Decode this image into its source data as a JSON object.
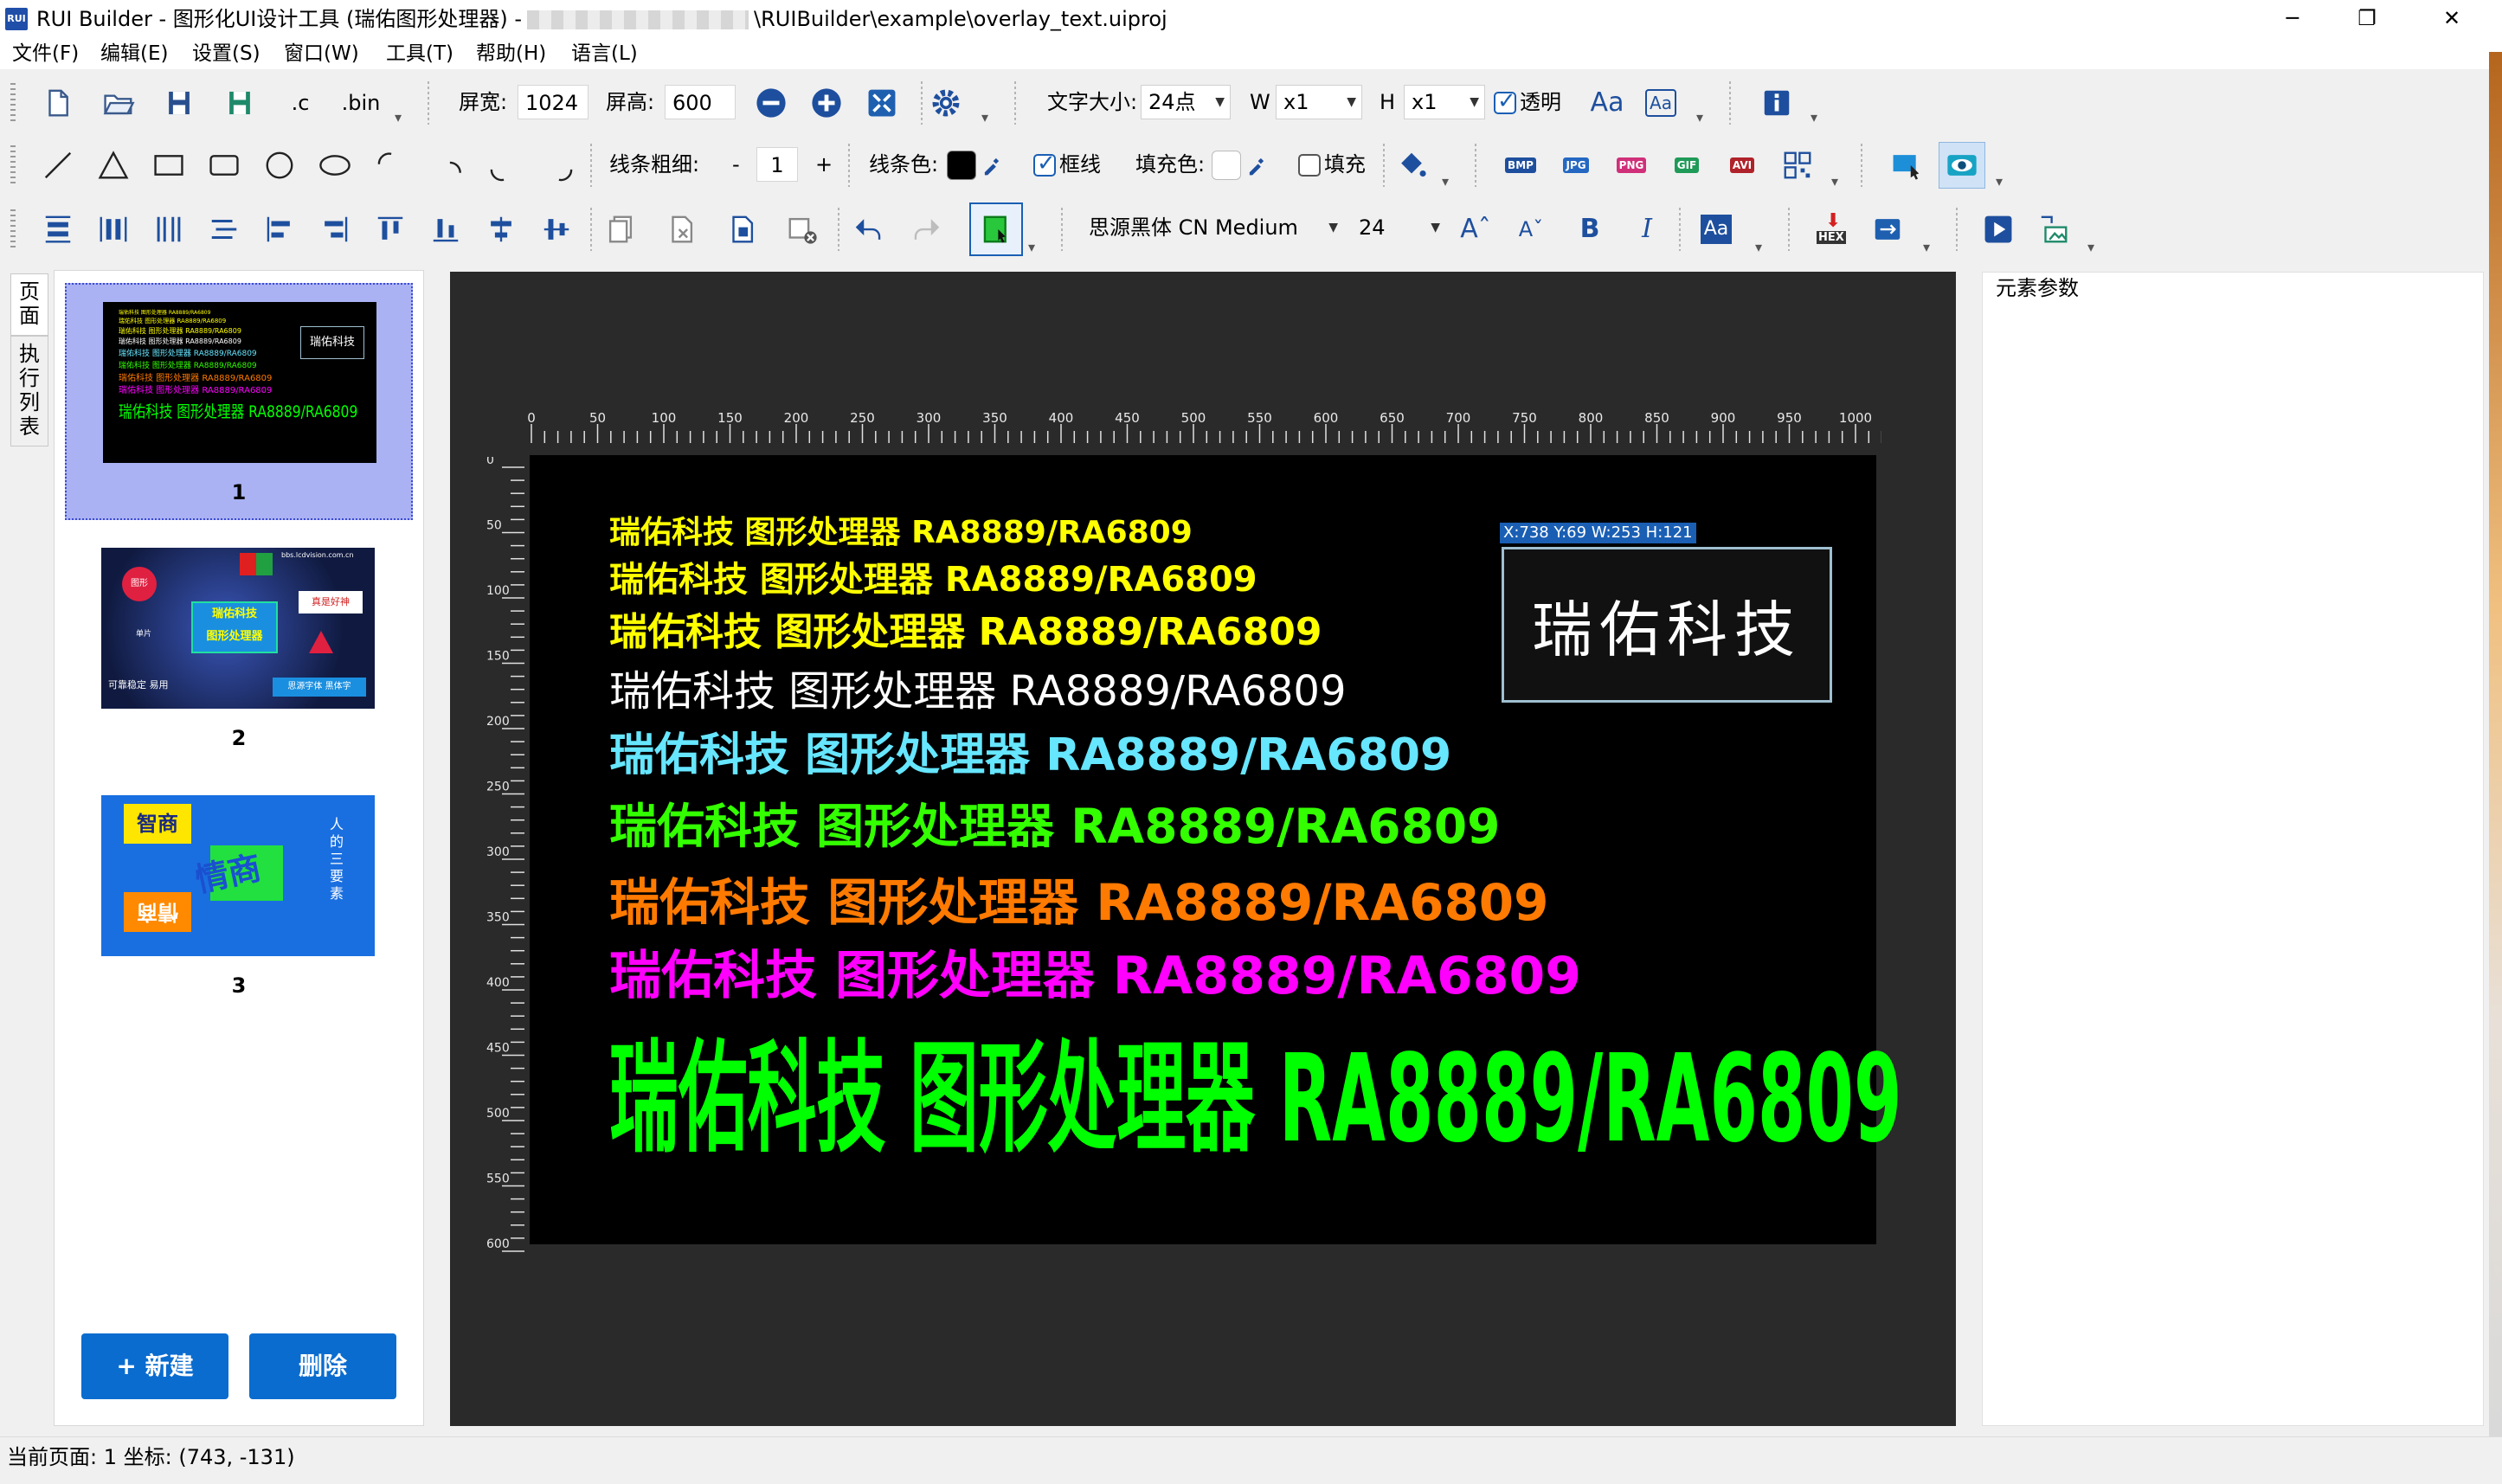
{
  "window": {
    "title_prefix": "RUI Builder - 图形化UI设计工具 (瑞佑图形处理器) -",
    "title_suffix": "\\RUIBuilder\\example\\overlay_text.uiproj",
    "app_icon": "RUI"
  },
  "menu": [
    "文件(F)",
    "编辑(E)",
    "设置(S)",
    "窗口(W)",
    "工具(T)",
    "帮助(H)",
    "语言(L)"
  ],
  "toolbar1": {
    "screen_width_label": "屏宽:",
    "screen_width_value": "1024",
    "screen_height_label": "屏高:",
    "screen_height_value": "600",
    "font_size_label": "文字大小:",
    "font_size_value": "24点",
    "w_label": "W",
    "w_value": "x1",
    "h_label": "H",
    "h_value": "x1",
    "transparent_label": "透明",
    "font_a_label": "Aa",
    "font_b_label": "Aa",
    "c_export_label": ".c",
    "bin_export_label": ".bin"
  },
  "toolbar2": {
    "line_width_label": "线条粗细:",
    "line_width_minus": "-",
    "line_width_value": "1",
    "line_width_plus": "+",
    "line_color_label": "线条色:",
    "line_color": "#000000",
    "border_label": "框线",
    "fill_color_label": "填充色:",
    "fill_label": "填充",
    "export_labels": [
      "BMP",
      "JPG",
      "PNG",
      "GIF",
      "AVI"
    ]
  },
  "toolbar3": {
    "font_family": "思源黑体 CN Medium",
    "font_size": "24",
    "bold": "B",
    "italic": "I",
    "aa": "Aa",
    "hex": "HEX"
  },
  "side_tabs": [
    "页面",
    "执行列表"
  ],
  "pages": [
    {
      "number": "1",
      "selected": true
    },
    {
      "number": "2",
      "selected": false
    },
    {
      "number": "3",
      "selected": false
    }
  ],
  "thumb1": {
    "lines": [
      "瑞佑科技 图形处理器 RA8889/RA6809",
      "瑞佑科技 图形处理器 RA8889/RA6809",
      "瑞佑科技 图形处理器 RA8889/RA6809",
      "瑞佑科技 图形处理器 RA8889/RA6809",
      "瑞佑科技 图形处理器 RA8889/RA6809",
      "瑞佑科技 图形处理器 RA8889/RA6809",
      "瑞佑科技 图形处理器 RA8889/RA6809",
      "瑞佑科技 图形处理器 RA8889/RA6809"
    ],
    "big": "瑞佑科技 图形处理器 RA8889/RA6809",
    "box": "瑞佑科技"
  },
  "thumb2": {
    "url": "bbs.lcdvision.com.cn",
    "center": "瑞佑科技",
    "center2": "图形处理器",
    "badge_left": "图形",
    "sub_left": "单片",
    "right_box": "真是好神",
    "bottom_left": "可靠稳定 易用",
    "bottom_right": "思源字体 黑体字"
  },
  "thumb3": {
    "box1": "智商",
    "box2": "情商",
    "center": "情商",
    "vertical": "人的三要素"
  },
  "buttons": {
    "new": "+ 新建",
    "delete": "删除"
  },
  "ruler": {
    "h_ticks": [
      "0",
      "50",
      "100",
      "150",
      "200",
      "250",
      "300",
      "350",
      "400",
      "450",
      "500",
      "550",
      "600",
      "650",
      "700",
      "750",
      "800",
      "850",
      "900",
      "950",
      "1000"
    ],
    "v_ticks": [
      "0",
      "50",
      "100",
      "150",
      "200",
      "250",
      "300",
      "350",
      "400",
      "450",
      "500",
      "550",
      "600"
    ]
  },
  "canvas": {
    "lines": [
      {
        "text": "瑞佑科技 图形处理器 RA8889/RA6809",
        "color": "#ffff00"
      },
      {
        "text": "瑞佑科技 图形处理器 RA8889/RA6809",
        "color": "#ffff00"
      },
      {
        "text": "瑞佑科技 图形处理器 RA8889/RA6809",
        "color": "#ffff00"
      },
      {
        "text": "瑞佑科技 图形处理器 RA8889/RA6809",
        "color": "#ffffff"
      },
      {
        "text": "瑞佑科技 图形处理器 RA8889/RA6809",
        "color": "#66e6ff"
      },
      {
        "text": "瑞佑科技 图形处理器 RA8889/RA6809",
        "color": "#33ff00"
      },
      {
        "text": "瑞佑科技 图形处理器 RA8889/RA6809",
        "color": "#ff7a00"
      },
      {
        "text": "瑞佑科技 图形处理器 RA8889/RA6809",
        "color": "#ff00ff"
      },
      {
        "text": "瑞佑科技 图形处理器 RA8889/RA6809",
        "color": "#00ff00"
      }
    ],
    "selection_label": "X:738 Y:69 W:253 H:121",
    "selection_text": "瑞佑科技"
  },
  "props": {
    "title": "元素参数"
  },
  "status": {
    "text": "当前页面: 1  坐标: (743, -131)"
  },
  "colors": {
    "accent": "#0a6ccf",
    "selected_page": "#aab2f4",
    "canvas_bg": "#2a2a2a",
    "screen_bg": "#000000"
  }
}
